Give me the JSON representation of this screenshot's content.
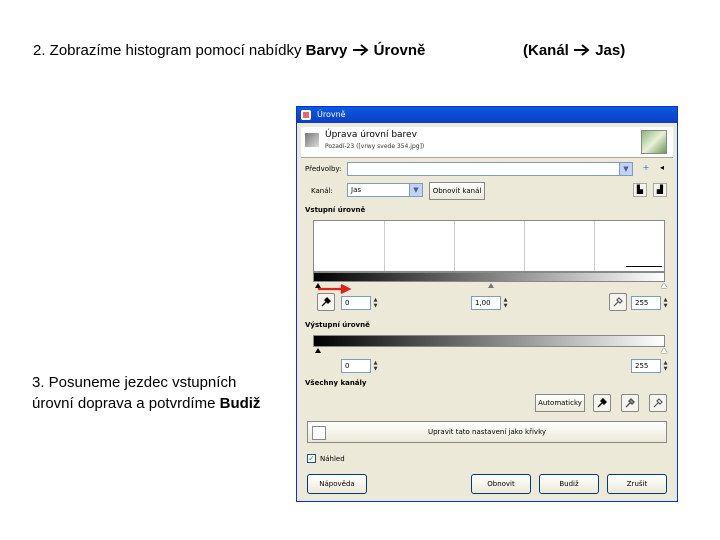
{
  "slide": {
    "step2_prefix": "2. Zobrazíme histogram pomocí nabídky ",
    "step2_menu1": "Barvy",
    "step2_menu2": "Úrovně",
    "step2_paren_open": "(Kanál",
    "step2_paren_close": "Jas)",
    "step3_text": "3. Posuneme jezdec vstupních úrovní doprava a potvrdíme ",
    "step3_bold": "Budiž"
  },
  "dialog": {
    "title": "Úrovně",
    "header_title": "Úprava úrovní barev",
    "header_subtitle": "Pozadí-23 ([vrwy svede 354.jpg])",
    "presets_label": "Předvolby:",
    "presets_value": "",
    "channel_label": "Kanál:",
    "channel_value": "Jas",
    "reset_channel_button": "Obnovit kanál",
    "input_levels_title": "Vstupní úrovně",
    "input_low": "0",
    "input_gamma": "1,00",
    "input_high": "255",
    "output_levels_title": "Výstupní úrovně",
    "output_low": "0",
    "output_high": "255",
    "all_channels_title": "Všechny kanály",
    "auto_button": "Automaticky",
    "edit_as_curves_button": "Upravit tato nastavení jako křivky",
    "preview_label": "Náhled",
    "preview_checked": true,
    "help_button": "Nápověda",
    "reset_button": "Obnovit",
    "ok_button": "Budiž",
    "cancel_button": "Zrušit"
  },
  "colors": {
    "titlebar": "#0a5ae0",
    "dialog_bg": "#ece9d8",
    "arrow": "#e0201a"
  }
}
